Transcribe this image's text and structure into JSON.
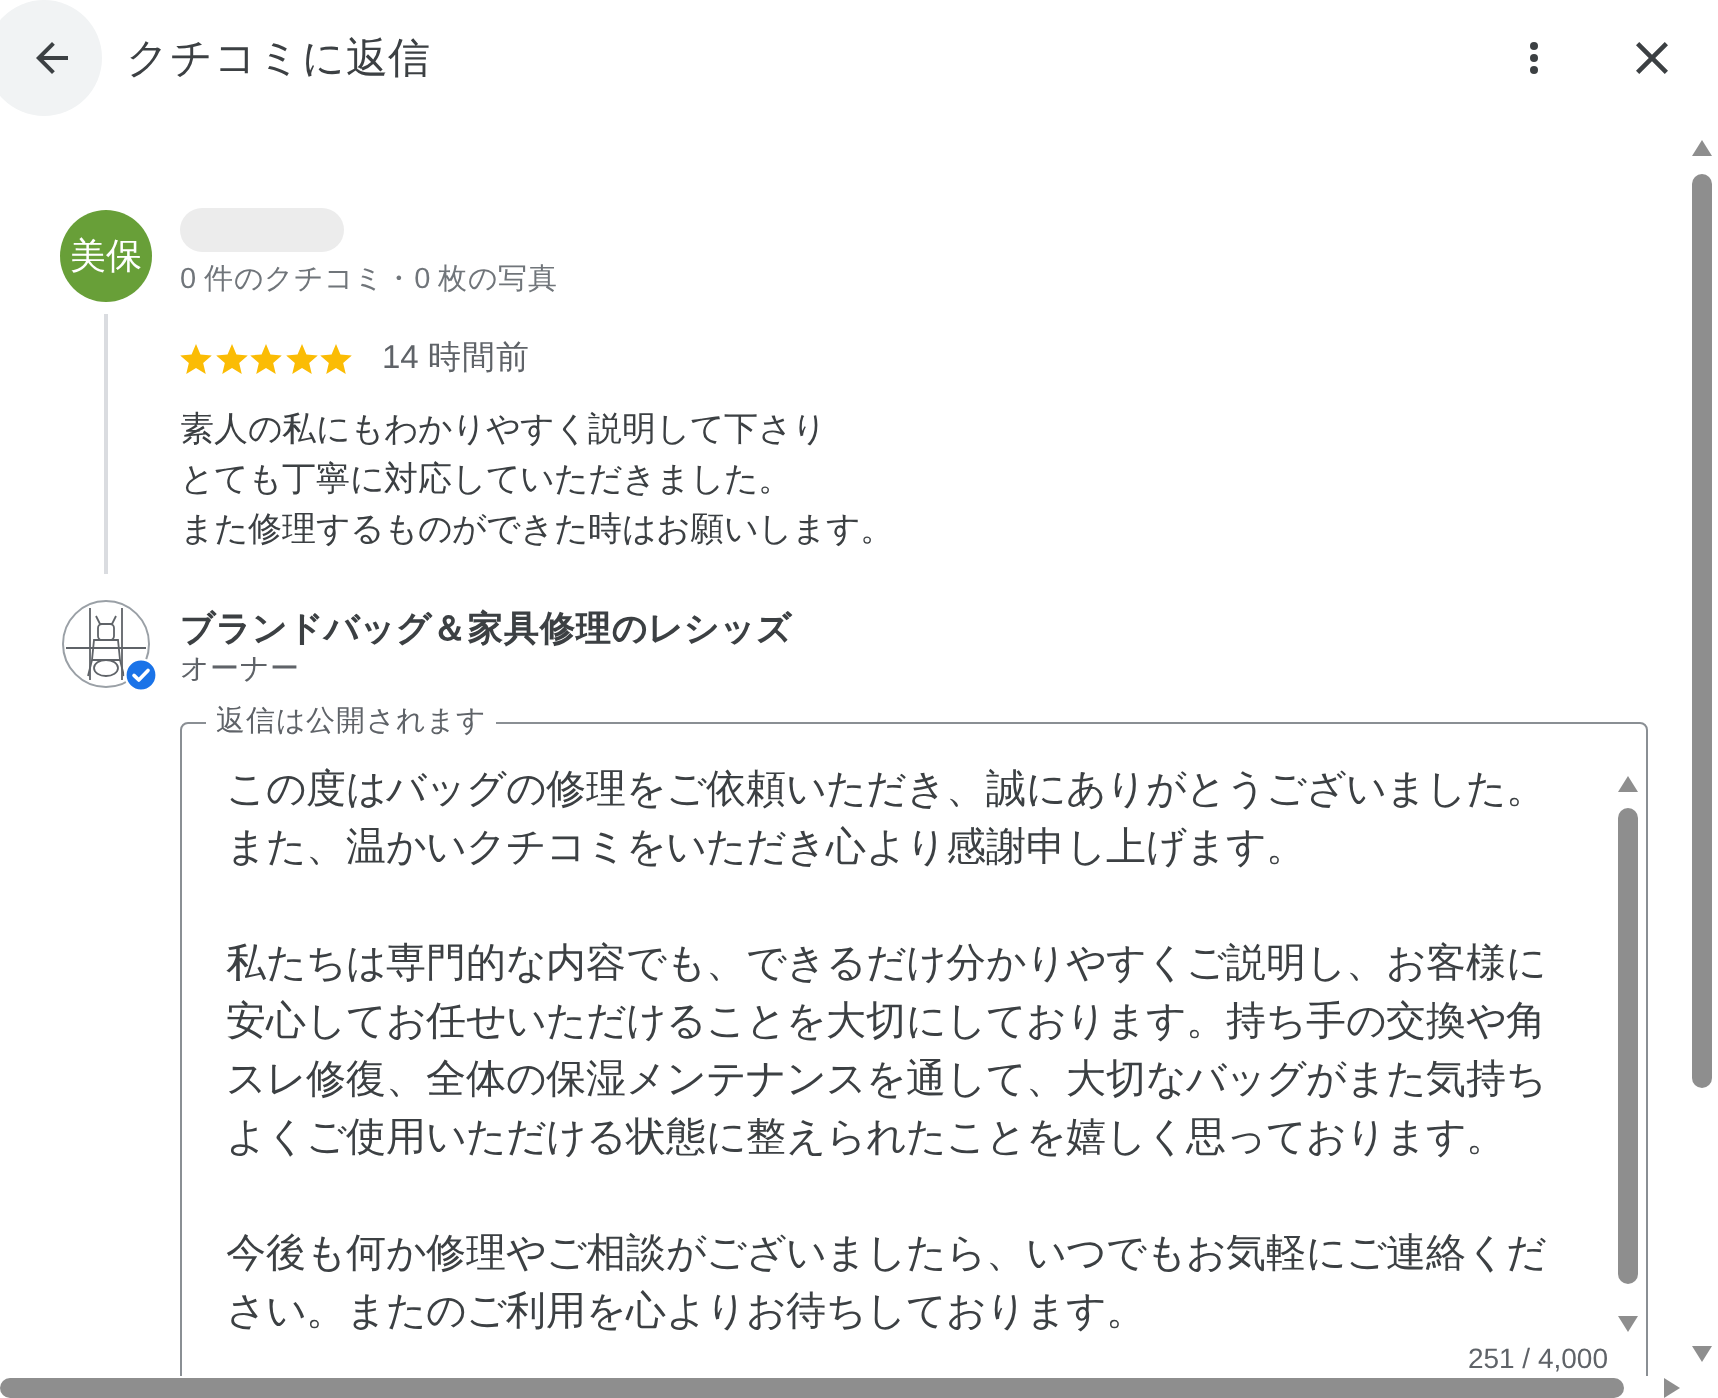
{
  "header": {
    "title": "クチコミに返信"
  },
  "review": {
    "avatar_text": "美保",
    "meta": "0 件のクチコミ・0 枚の写真",
    "stars": 5,
    "time": "14 時間前",
    "lines": [
      "素人の私にもわかりやすく説明して下さり",
      "とても丁寧に対応していただきました。",
      "また修理するものができた時はお願いします。"
    ]
  },
  "owner": {
    "name": "ブランドバッグ＆家具修理のレシッズ",
    "role": "オーナー",
    "verified": true
  },
  "reply_field": {
    "label": "返信は公開されます",
    "paragraphs": [
      "この度はバッグの修理をご依頼いただき、誠にありがとうございました。また、温かいクチコミをいただき心より感謝申し上げます。",
      "私たちは専門的な内容でも、できるだけ分かりやすくご説明し、お客様に安心してお任せいただけることを大切にしております。持ち手の交換や角スレ修復、全体の保湿メンテナンスを通して、大切なバッグがまた気持ちよくご使用いただける状態に整えられたことを嬉しく思っております。",
      "今後も何か修理やご相談がございましたら、いつでもお気軽にご連絡ください。またのご利用を心よりお待ちしております。"
    ],
    "counter": "251 / 4,000"
  }
}
